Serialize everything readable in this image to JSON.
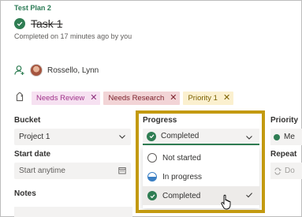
{
  "plan": {
    "name": "Test Plan 2"
  },
  "task": {
    "title": "Task 1",
    "completed_meta": "Completed on 17 minutes ago by you"
  },
  "assignee": {
    "name": "Rossello, Lynn"
  },
  "labels": [
    {
      "text": "Needs Review",
      "color": "#f6e1f1"
    },
    {
      "text": "Needs Research",
      "color": "#f2d4d6"
    },
    {
      "text": "Priority 1",
      "color": "#fbf0cf"
    }
  ],
  "bucket": {
    "label": "Bucket",
    "value": "Project 1"
  },
  "start_date": {
    "label": "Start date",
    "placeholder": "Start anytime"
  },
  "progress": {
    "label": "Progress",
    "value": "Completed",
    "options": [
      "Not started",
      "In progress",
      "Completed"
    ],
    "selected": "Completed"
  },
  "priority": {
    "label": "Priority",
    "value_partial": "Me"
  },
  "repeat": {
    "label": "Repeat",
    "value_partial": "Do"
  },
  "notes": {
    "label": "Notes"
  },
  "colors": {
    "accent_green": "#2f7d53",
    "highlight_gold": "#c39a10"
  }
}
